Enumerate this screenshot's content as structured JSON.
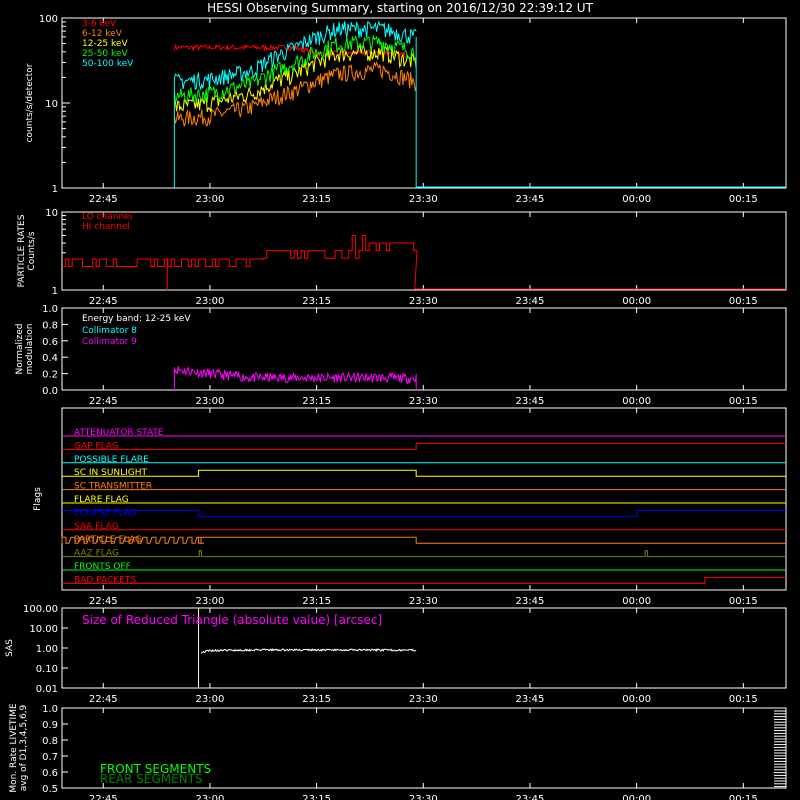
{
  "title": "HESSI Observing Summary, starting on 2016/12/30 22:39:12 UT",
  "time_ticks": [
    "22:45",
    "23:00",
    "23:15",
    "23:30",
    "23:45",
    "00:00",
    "00:15"
  ],
  "colors": {
    "background": "#000000",
    "axes": "#ffffff"
  },
  "chart_data": [
    {
      "type": "line",
      "panel": "count-rates",
      "ylabel": "counts/s/detector",
      "yscale": "log",
      "ylim": [
        1,
        100
      ],
      "yticks": [
        "1",
        "10",
        "100"
      ],
      "xlim_minutes": [
        22.65,
        61.2
      ],
      "legend": [
        {
          "name": "3-6 keV",
          "color": "#ff0000"
        },
        {
          "name": "6-12 keV",
          "color": "#ff8000"
        },
        {
          "name": "12-25 keV",
          "color": "#ffff00"
        },
        {
          "name": "25-50 keV",
          "color": "#00ff00"
        },
        {
          "name": "50-100 keV",
          "color": "#00ffff"
        }
      ],
      "series": [
        {
          "name": "3-6 keV",
          "color": "#ff0000",
          "x": [
            22.92,
            23.2,
            23.25,
            23.3,
            23.4,
            23.5
          ],
          "y": [
            45,
            45,
            38,
            38,
            40,
            35
          ]
        },
        {
          "name": "6-12 keV",
          "color": "#ff8000",
          "x": [
            22.92,
            23.0,
            23.1,
            23.2,
            23.3,
            23.4,
            23.48
          ],
          "y": [
            6.5,
            7,
            9,
            14,
            22,
            25,
            18
          ]
        },
        {
          "name": "12-25 keV",
          "color": "#ffff00",
          "x": [
            22.92,
            23.0,
            23.1,
            23.2,
            23.3,
            23.4,
            23.48
          ],
          "y": [
            9,
            10,
            13,
            22,
            38,
            40,
            30
          ]
        },
        {
          "name": "25-50 keV",
          "color": "#00ff00",
          "x": [
            22.92,
            23.0,
            23.1,
            23.2,
            23.3,
            23.4,
            23.48
          ],
          "y": [
            12,
            13,
            17,
            30,
            50,
            52,
            40
          ]
        },
        {
          "name": "50-100 keV",
          "color": "#00ffff",
          "x": [
            22.92,
            23.0,
            23.1,
            23.2,
            23.3,
            23.4,
            23.48
          ],
          "y": [
            18,
            19,
            24,
            45,
            75,
            75,
            60
          ]
        }
      ]
    },
    {
      "type": "line",
      "panel": "particle-rates",
      "ylabel": "PARTICLE RATES Counts/s",
      "yscale": "log",
      "ylim": [
        1,
        10
      ],
      "yticks": [
        "1",
        "10"
      ],
      "legend": [
        {
          "name": "LO channel",
          "color": "#ff0000"
        },
        {
          "name": "HI channel",
          "color": "#ff0000"
        }
      ],
      "series": [
        {
          "name": "LO channel",
          "color": "#ff0000",
          "x": [
            22.65,
            23.1,
            23.12,
            23.35,
            23.37,
            23.5
          ],
          "y": [
            2.5,
            2.5,
            3.2,
            3.2,
            4.0,
            1.0
          ]
        }
      ]
    },
    {
      "type": "line",
      "panel": "modulation",
      "ylabel": "Normalized modulation",
      "ylim": [
        0,
        1
      ],
      "yticks": [
        "0.0",
        "0.2",
        "0.4",
        "0.6",
        "0.8",
        "1.0"
      ],
      "annotation": "Energy band: 12-25 keV",
      "legend": [
        {
          "name": "Collimator 8",
          "color": "#00ffff"
        },
        {
          "name": "Collimator 9",
          "color": "#ff00ff"
        }
      ],
      "series": [
        {
          "name": "Collimator 9",
          "color": "#ff00ff",
          "x": [
            22.92,
            23.0,
            23.05,
            23.1,
            23.2,
            23.3,
            23.4,
            23.48
          ],
          "y": [
            0.25,
            0.2,
            0.17,
            0.15,
            0.15,
            0.15,
            0.15,
            0.14
          ]
        }
      ]
    },
    {
      "type": "line",
      "panel": "flags",
      "ylabel": "Flags",
      "flags": [
        {
          "name": "ATTENUATOR STATE",
          "color": "#ff00ff"
        },
        {
          "name": "GAP FLAG",
          "color": "#ff0000"
        },
        {
          "name": "POSSIBLE FLARE",
          "color": "#00ffff"
        },
        {
          "name": "SC IN SUNLIGHT",
          "color": "#ffff00"
        },
        {
          "name": "SC TRANSMITTER",
          "color": "#ff8000"
        },
        {
          "name": "FLARE FLAG",
          "color": "#ffff00"
        },
        {
          "name": "ECLIPSE FLAG",
          "color": "#0000ff"
        },
        {
          "name": "SAA FLAG",
          "color": "#ff0000"
        },
        {
          "name": "PARTICLE FLAG",
          "color": "#ff8000"
        },
        {
          "name": "AAZ FLAG",
          "color": "#808000"
        },
        {
          "name": "FRONTS OFF",
          "color": "#00ff00"
        },
        {
          "name": "BAD PACKETS",
          "color": "#ff0000"
        }
      ]
    },
    {
      "type": "line",
      "panel": "sas",
      "ylabel": "SAS",
      "yscale": "log",
      "ylim": [
        0.01,
        100
      ],
      "yticks": [
        "100.00",
        "10.00",
        "1.00",
        "0.10",
        "0.01"
      ],
      "legend": [
        {
          "name": "Size of Reduced Triangle (absolute value) [arcsec]",
          "color": "#ff00ff"
        }
      ],
      "series": [
        {
          "name": "Size of Reduced Triangle (absolute value) [arcsec]",
          "color": "#ffffff",
          "x": [
            22.97,
            22.98,
            23.0,
            23.1,
            23.2,
            23.3,
            23.48
          ],
          "y": [
            0.9,
            0.6,
            0.75,
            0.8,
            0.8,
            0.8,
            0.78
          ]
        }
      ]
    },
    {
      "type": "line",
      "panel": "livetime",
      "ylabel": "Mon. Rate LIVETIME avg of D1,3,4,5,6,9",
      "ylim": [
        0.5,
        1.0
      ],
      "yticks": [
        "0.5",
        "0.6",
        "0.7",
        "0.8",
        "0.9",
        "1.0"
      ],
      "legend": [
        {
          "name": "FRONT SEGMENTS",
          "color": "#00ff00"
        },
        {
          "name": "REAR SEGMENTS",
          "color": "#008000"
        }
      ],
      "series": []
    }
  ]
}
